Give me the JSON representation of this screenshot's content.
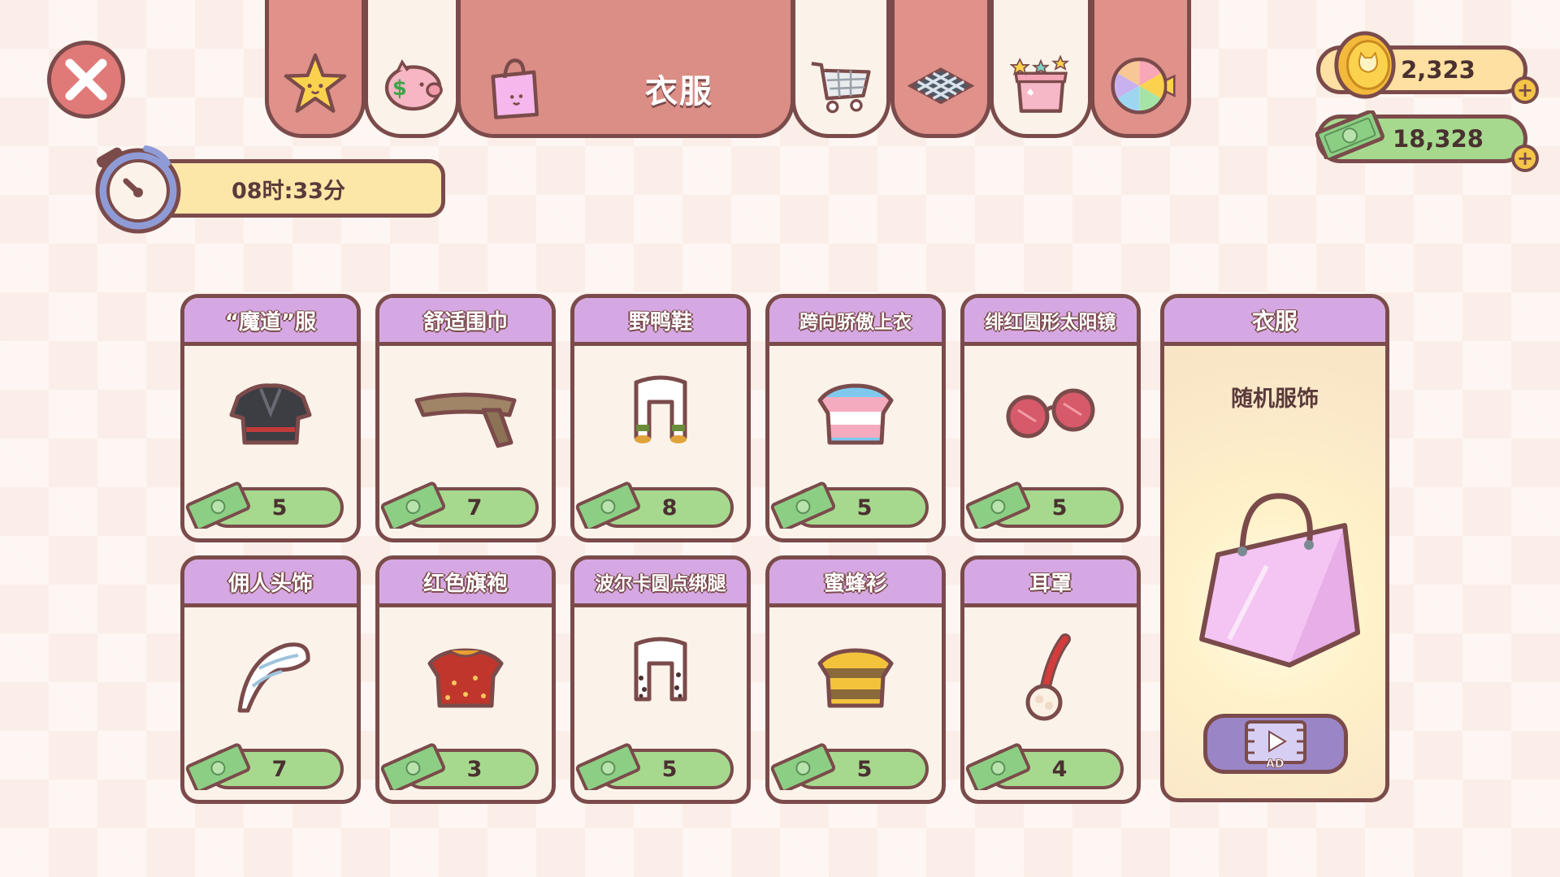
{
  "header": {
    "active_tab_title": "衣服",
    "tabs": [
      {
        "id": "star",
        "icon": "star-icon"
      },
      {
        "id": "piggy",
        "icon": "piggy-bank-icon"
      },
      {
        "id": "clothes",
        "icon": "shopping-bag-icon",
        "label": "衣服"
      },
      {
        "id": "cart",
        "icon": "shopping-cart-icon"
      },
      {
        "id": "floor",
        "icon": "floor-tiles-icon"
      },
      {
        "id": "gift",
        "icon": "gift-box-icon"
      },
      {
        "id": "wheel",
        "icon": "prize-wheel-icon"
      }
    ]
  },
  "timer": {
    "text": "08时:33分",
    "icon": "stopwatch-icon"
  },
  "currency": {
    "coins": "2,323",
    "cash": "18,328",
    "coin_icon": "coin-icon",
    "cash_icon": "cash-icon",
    "plus": "+"
  },
  "items": [
    {
      "name": "“魔道”服",
      "price": "5",
      "icon": "dark-robe-icon"
    },
    {
      "name": "舒适围巾",
      "price": "7",
      "icon": "scarf-icon"
    },
    {
      "name": "野鸭鞋",
      "price": "8",
      "icon": "duck-shoes-icon"
    },
    {
      "name": "跨向骄傲上衣",
      "price": "5",
      "icon": "pride-shirt-icon"
    },
    {
      "name": "绯红圆形太阳镜",
      "price": "5",
      "icon": "red-sunglasses-icon"
    },
    {
      "name": "佣人头饰",
      "price": "7",
      "icon": "maid-headpiece-icon"
    },
    {
      "name": "红色旗袍",
      "price": "3",
      "icon": "red-qipao-icon"
    },
    {
      "name": "波尔卡圆点绑腿",
      "price": "5",
      "icon": "polka-dot-leggings-icon"
    },
    {
      "name": "蜜蜂衫",
      "price": "5",
      "icon": "bee-shirt-icon"
    },
    {
      "name": "耳罩",
      "price": "4",
      "icon": "earmuffs-icon"
    }
  ],
  "random_bag": {
    "title": "衣服",
    "subtitle": "随机服饰",
    "ad_label": "AD"
  },
  "colors": {
    "outline": "#7b4b4b",
    "tab_red": "#df918a",
    "card_header": "#d6a8e3",
    "price_green": "#a6d98e",
    "coin_bar": "#fde0a2"
  }
}
